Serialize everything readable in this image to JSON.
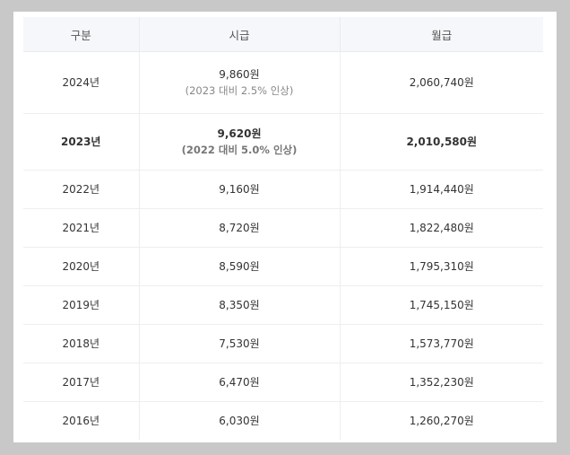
{
  "table": {
    "headers": [
      "구분",
      "시급",
      "월급"
    ],
    "rows": [
      {
        "year": "2024년",
        "hourly": "9,860원",
        "note": "(2023 대비 2.5% 인상)",
        "monthly": "2,060,740원"
      },
      {
        "year": "2023년",
        "hourly": "9,620원",
        "note": "(2022 대비 5.0% 인상)",
        "monthly": "2,010,580원"
      },
      {
        "year": "2022년",
        "hourly": "9,160원",
        "monthly": "1,914,440원"
      },
      {
        "year": "2021년",
        "hourly": "8,720원",
        "monthly": "1,822,480원"
      },
      {
        "year": "2020년",
        "hourly": "8,590원",
        "monthly": "1,795,310원"
      },
      {
        "year": "2019년",
        "hourly": "8,350원",
        "monthly": "1,745,150원"
      },
      {
        "year": "2018년",
        "hourly": "7,530원",
        "monthly": "1,573,770원"
      },
      {
        "year": "2017년",
        "hourly": "6,470원",
        "monthly": "1,352,230원"
      },
      {
        "year": "2016년",
        "hourly": "6,030원",
        "monthly": "1,260,270원"
      }
    ]
  }
}
